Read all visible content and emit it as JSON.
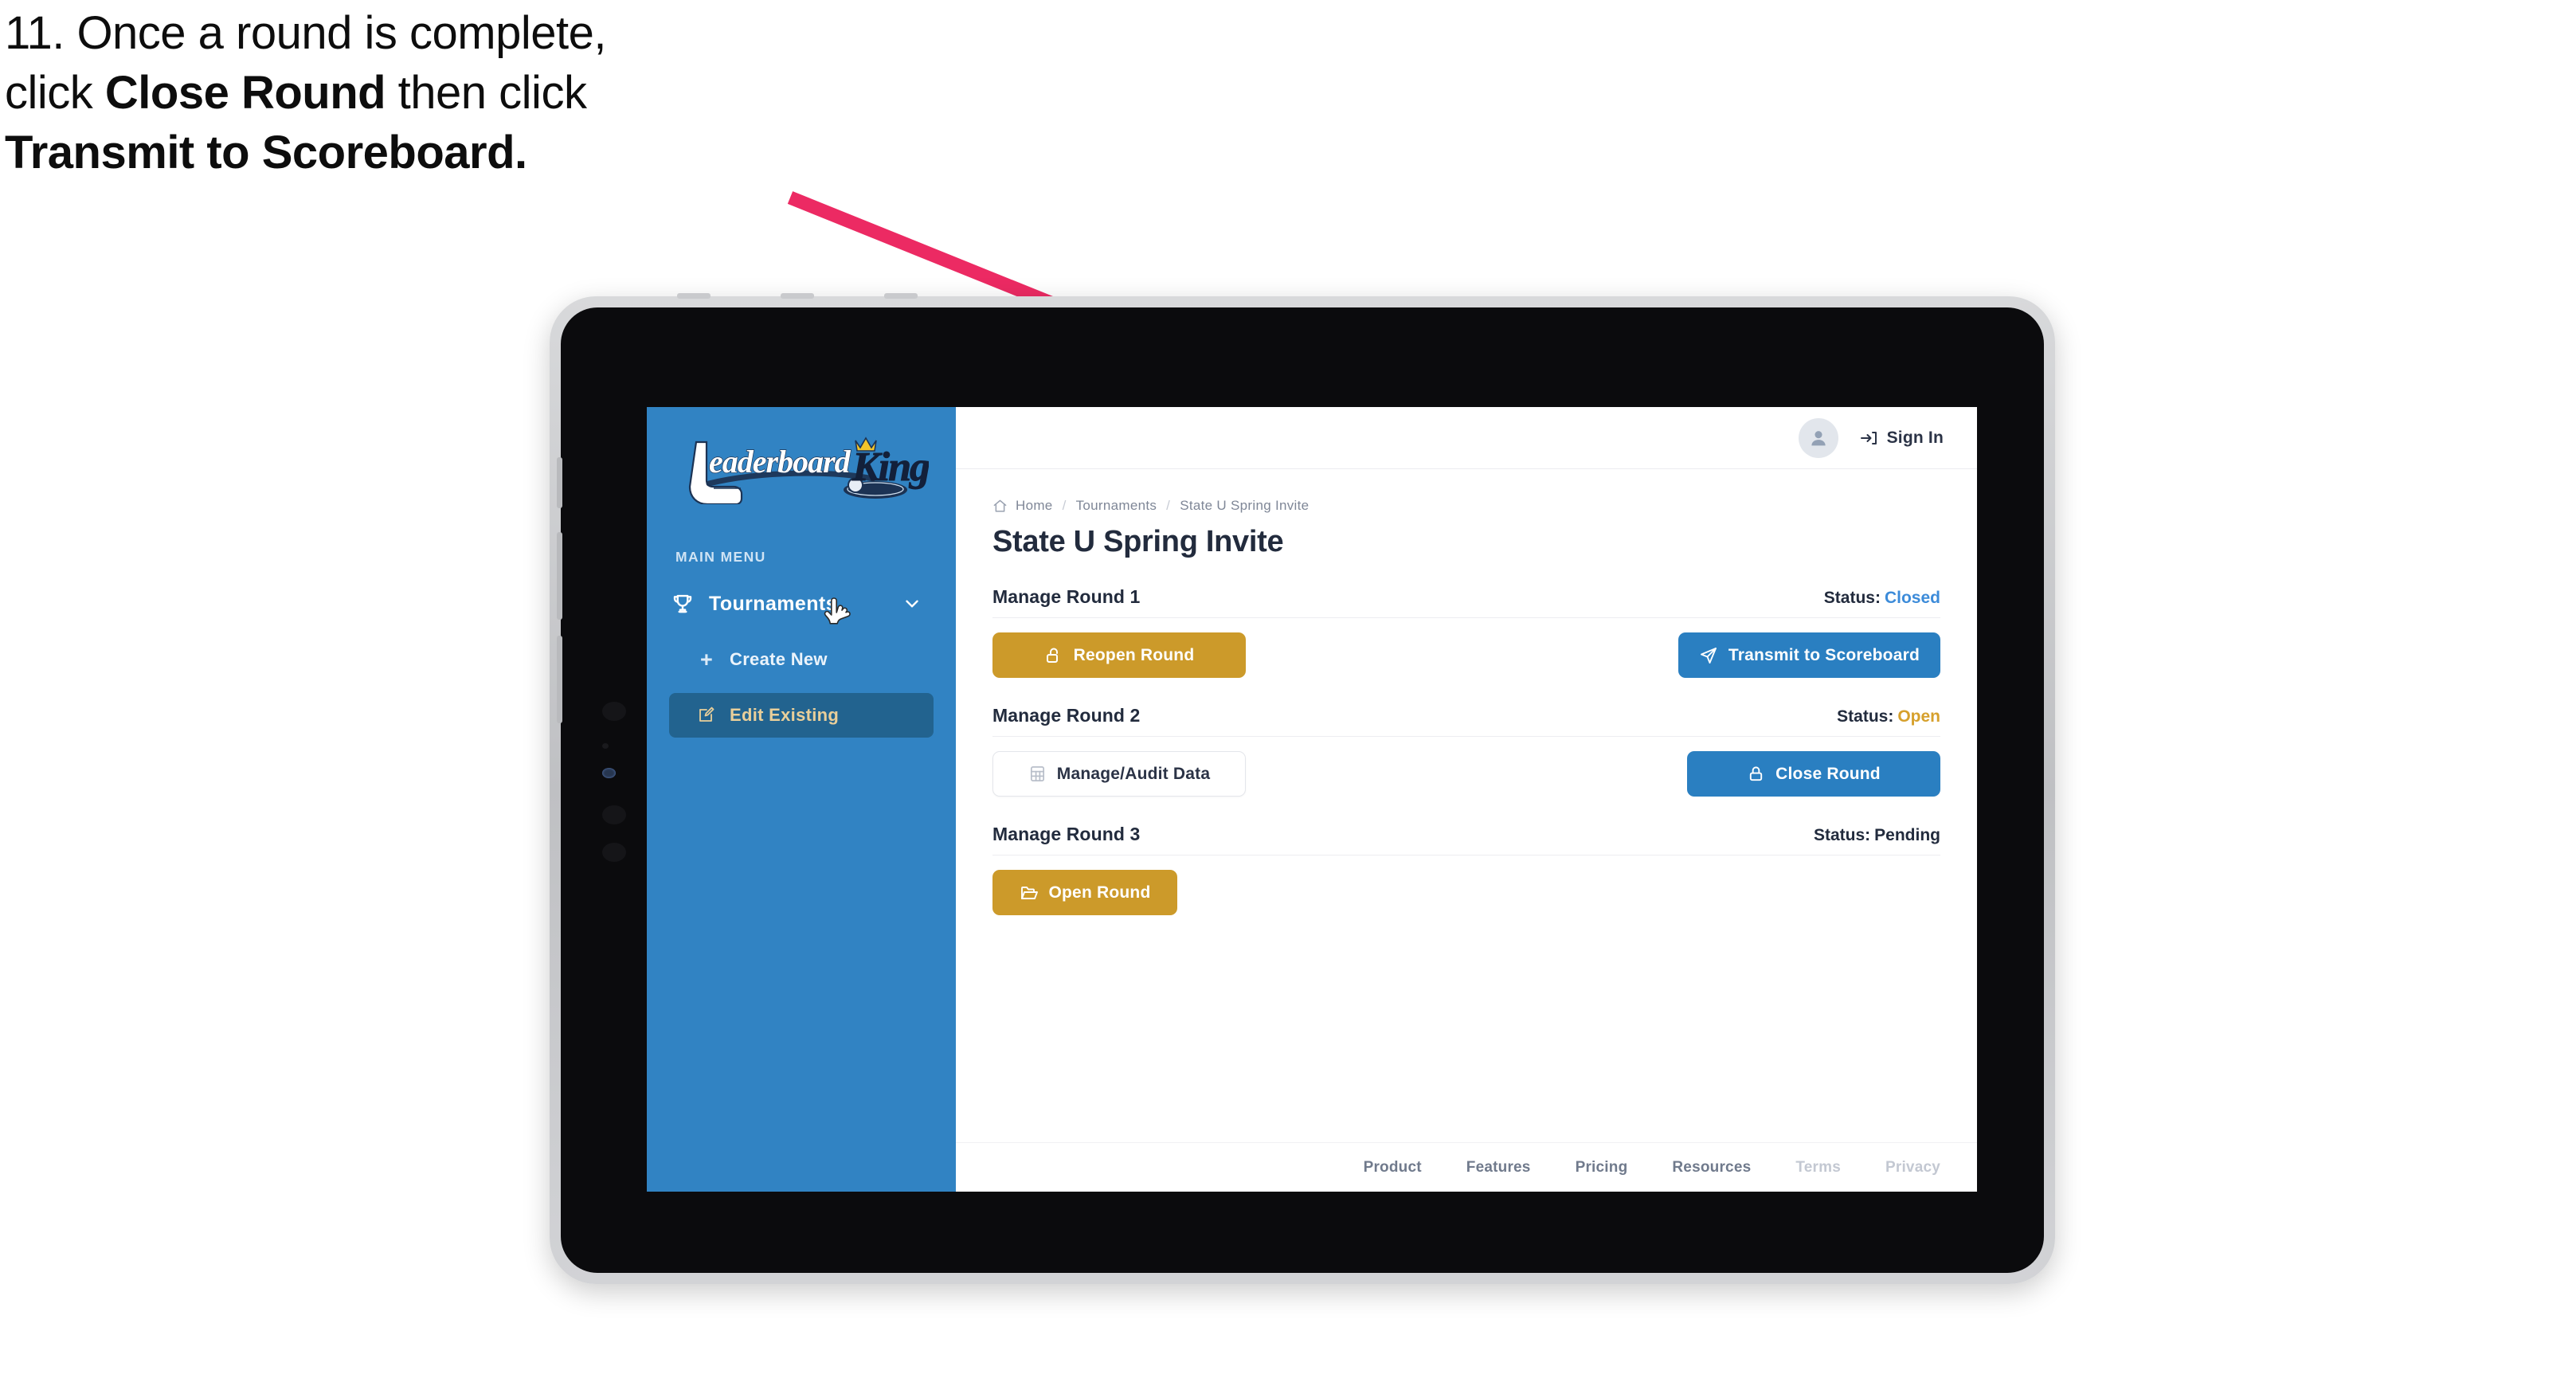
{
  "caption": {
    "line1": "11. Once a round is complete,",
    "line2_pre": "click ",
    "line2_bold": "Close Round",
    "line2_post": " then click",
    "line3_bold": "Transmit to Scoreboard."
  },
  "annotation": {
    "arrow_color": "#ec2a63"
  },
  "colors": {
    "sidebar_blue": "#3183c3",
    "accent_gold": "#cc9a2a",
    "accent_blue": "#2a7fc1",
    "status_closed": "#3c8bd9",
    "status_open": "#d6a02c",
    "text_dark": "#222b3d"
  },
  "sidebar": {
    "logo_primary": "Leaderboard",
    "logo_secondary": "King",
    "section_label": "MAIN MENU",
    "items": [
      {
        "label": "Tournaments",
        "icon": "trophy-icon",
        "expand_icon": "chevron-down-icon"
      },
      {
        "label": "Create New",
        "icon": "plus-icon"
      },
      {
        "label": "Edit Existing",
        "icon": "edit-square-icon",
        "active": true
      }
    ]
  },
  "topbar": {
    "avatar_icon": "user-avatar-icon",
    "signin_icon": "sign-in-icon",
    "signin_label": "Sign In"
  },
  "breadcrumb": {
    "home_icon": "home-icon",
    "items": [
      "Home",
      "Tournaments",
      "State U Spring Invite"
    ],
    "separator": "/"
  },
  "page": {
    "title": "State U Spring Invite"
  },
  "rounds": [
    {
      "title": "Manage Round 1",
      "status_label": "Status:",
      "status_value": "Closed",
      "status_class": "v-closed",
      "left_button": {
        "label": "Reopen Round",
        "icon": "unlock-icon",
        "style": "gold"
      },
      "right_button": {
        "label": "Transmit to Scoreboard",
        "icon": "send-icon",
        "style": "blue"
      }
    },
    {
      "title": "Manage Round 2",
      "status_label": "Status:",
      "status_value": "Open",
      "status_class": "v-open",
      "left_button": {
        "label": "Manage/Audit Data",
        "icon": "table-icon",
        "style": "ghost"
      },
      "right_button": {
        "label": "Close Round",
        "icon": "lock-icon",
        "style": "blue"
      }
    },
    {
      "title": "Manage Round 3",
      "status_label": "Status:",
      "status_value": "Pending",
      "status_class": "v-pending",
      "left_button": {
        "label": "Open Round",
        "icon": "folder-open-icon",
        "style": "gold-narrow"
      },
      "right_button": null
    }
  ],
  "footer": {
    "links": [
      {
        "label": "Product",
        "dim": false
      },
      {
        "label": "Features",
        "dim": false
      },
      {
        "label": "Pricing",
        "dim": false
      },
      {
        "label": "Resources",
        "dim": false
      },
      {
        "label": "Terms",
        "dim": true
      },
      {
        "label": "Privacy",
        "dim": true
      }
    ]
  },
  "cursor": {
    "icon": "pointing-hand-cursor"
  }
}
